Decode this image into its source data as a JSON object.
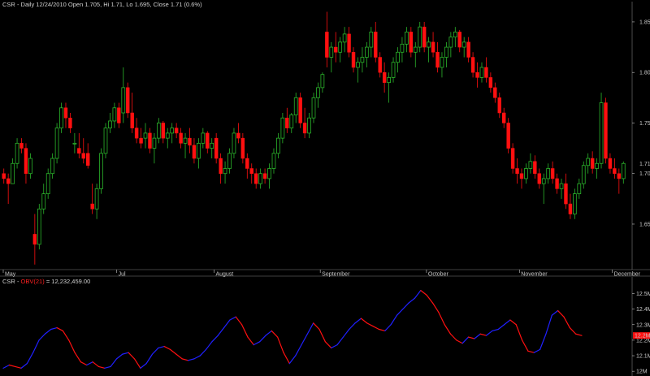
{
  "header": {
    "symbol": "CSR",
    "title": "Daily 12/24/2010 Open 1.705, Hi 1.71, Lo 1.695, Close 1.71 (0.6%)"
  },
  "indicator": {
    "symbol": "CSR",
    "name": "OBV(21)",
    "value": "= 12,232,459.00"
  },
  "colors": {
    "up": "#2bb52b",
    "down": "#ff1010",
    "obv_up": "#2020ff",
    "obv_down": "#ff1010",
    "axis": "#c8c8c8",
    "background": "#000000"
  },
  "chart_data": [
    {
      "type": "candlestick",
      "title": "CSR - Daily 12/24/2010 Open 1.705, Hi 1.71, Lo 1.695, Close 1.71 (0.6%)",
      "y_ticks": [
        "1.650",
        "1.700",
        "1.71",
        "1.750",
        "1.800",
        "1.850"
      ],
      "ylim": [
        1.605,
        1.862
      ],
      "x_months": [
        "May",
        "Jul",
        "August",
        "September",
        "October",
        "November",
        "December"
      ],
      "last_value": "1.71",
      "ohlc": [
        [
          1.7,
          1.705,
          1.69,
          1.695
        ],
        [
          1.695,
          1.7,
          1.67,
          1.69
        ],
        [
          1.69,
          1.715,
          1.69,
          1.71
        ],
        [
          1.71,
          1.735,
          1.705,
          1.73
        ],
        [
          1.73,
          1.735,
          1.72,
          1.725
        ],
        [
          1.725,
          1.73,
          1.69,
          1.7
        ],
        [
          1.7,
          1.72,
          1.695,
          1.715
        ],
        [
          1.64,
          1.66,
          1.61,
          1.63
        ],
        [
          1.63,
          1.67,
          1.625,
          1.665
        ],
        [
          1.665,
          1.69,
          1.66,
          1.68
        ],
        [
          1.68,
          1.705,
          1.675,
          1.7
        ],
        [
          1.7,
          1.72,
          1.695,
          1.715
        ],
        [
          1.715,
          1.75,
          1.71,
          1.745
        ],
        [
          1.745,
          1.77,
          1.74,
          1.765
        ],
        [
          1.765,
          1.77,
          1.745,
          1.755
        ],
        [
          1.755,
          1.76,
          1.74,
          1.745
        ],
        [
          1.73,
          1.74,
          1.72,
          1.73
        ],
        [
          1.725,
          1.74,
          1.715,
          1.72
        ],
        [
          1.72,
          1.735,
          1.71,
          1.715
        ],
        [
          1.72,
          1.73,
          1.705,
          1.708
        ],
        [
          1.67,
          1.69,
          1.66,
          1.665
        ],
        [
          1.665,
          1.69,
          1.655,
          1.685
        ],
        [
          1.685,
          1.725,
          1.68,
          1.72
        ],
        [
          1.72,
          1.75,
          1.715,
          1.745
        ],
        [
          1.745,
          1.76,
          1.74,
          1.752
        ],
        [
          1.752,
          1.77,
          1.745,
          1.765
        ],
        [
          1.765,
          1.77,
          1.745,
          1.75
        ],
        [
          1.76,
          1.805,
          1.75,
          1.785
        ],
        [
          1.785,
          1.79,
          1.755,
          1.76
        ],
        [
          1.76,
          1.78,
          1.74,
          1.745
        ],
        [
          1.745,
          1.755,
          1.73,
          1.735
        ],
        [
          1.735,
          1.745,
          1.725,
          1.73
        ],
        [
          1.735,
          1.75,
          1.725,
          1.74
        ],
        [
          1.74,
          1.745,
          1.72,
          1.725
        ],
        [
          1.725,
          1.74,
          1.71,
          1.735
        ],
        [
          1.735,
          1.755,
          1.73,
          1.75
        ],
        [
          1.75,
          1.752,
          1.73,
          1.735
        ],
        [
          1.735,
          1.745,
          1.725,
          1.74
        ],
        [
          1.74,
          1.75,
          1.73,
          1.745
        ],
        [
          1.745,
          1.75,
          1.735,
          1.74
        ],
        [
          1.74,
          1.745,
          1.725,
          1.73
        ],
        [
          1.73,
          1.74,
          1.715,
          1.735
        ],
        [
          1.735,
          1.745,
          1.72,
          1.728
        ],
        [
          1.728,
          1.735,
          1.71,
          1.715
        ],
        [
          1.715,
          1.735,
          1.705,
          1.73
        ],
        [
          1.73,
          1.745,
          1.725,
          1.74
        ],
        [
          1.74,
          1.742,
          1.72,
          1.725
        ],
        [
          1.725,
          1.735,
          1.715,
          1.73
        ],
        [
          1.735,
          1.74,
          1.71,
          1.715
        ],
        [
          1.715,
          1.72,
          1.69,
          1.7
        ],
        [
          1.7,
          1.712,
          1.69,
          1.705
        ],
        [
          1.705,
          1.725,
          1.7,
          1.72
        ],
        [
          1.72,
          1.745,
          1.715,
          1.74
        ],
        [
          1.74,
          1.75,
          1.73,
          1.735
        ],
        [
          1.735,
          1.74,
          1.71,
          1.715
        ],
        [
          1.715,
          1.72,
          1.695,
          1.705
        ],
        [
          1.705,
          1.71,
          1.69,
          1.7
        ],
        [
          1.7,
          1.705,
          1.685,
          1.69
        ],
        [
          1.69,
          1.705,
          1.685,
          1.7
        ],
        [
          1.7,
          1.705,
          1.69,
          1.695
        ],
        [
          1.695,
          1.71,
          1.685,
          1.705
        ],
        [
          1.705,
          1.725,
          1.7,
          1.72
        ],
        [
          1.72,
          1.74,
          1.715,
          1.735
        ],
        [
          1.735,
          1.76,
          1.73,
          1.755
        ],
        [
          1.755,
          1.765,
          1.74,
          1.745
        ],
        [
          1.745,
          1.76,
          1.74,
          1.758
        ],
        [
          1.758,
          1.78,
          1.75,
          1.775
        ],
        [
          1.775,
          1.78,
          1.745,
          1.75
        ],
        [
          1.75,
          1.765,
          1.735,
          1.74
        ],
        [
          1.74,
          1.76,
          1.735,
          1.755
        ],
        [
          1.755,
          1.78,
          1.75,
          1.775
        ],
        [
          1.775,
          1.79,
          1.765,
          1.785
        ],
        [
          1.785,
          1.8,
          1.78,
          1.798
        ],
        [
          1.84,
          1.86,
          1.805,
          1.815
        ],
        [
          1.815,
          1.83,
          1.8,
          1.825
        ],
        [
          1.825,
          1.84,
          1.81,
          1.82
        ],
        [
          1.82,
          1.835,
          1.81,
          1.83
        ],
        [
          1.83,
          1.845,
          1.82,
          1.838
        ],
        [
          1.838,
          1.845,
          1.815,
          1.82
        ],
        [
          1.82,
          1.825,
          1.8,
          1.805
        ],
        [
          1.805,
          1.815,
          1.79,
          1.81
        ],
        [
          1.81,
          1.825,
          1.8,
          1.815
        ],
        [
          1.815,
          1.83,
          1.805,
          1.825
        ],
        [
          1.825,
          1.845,
          1.815,
          1.84
        ],
        [
          1.84,
          1.85,
          1.81,
          1.815
        ],
        [
          1.815,
          1.82,
          1.795,
          1.8
        ],
        [
          1.8,
          1.81,
          1.78,
          1.79
        ],
        [
          1.79,
          1.8,
          1.77,
          1.795
        ],
        [
          1.795,
          1.815,
          1.79,
          1.81
        ],
        [
          1.81,
          1.825,
          1.8,
          1.82
        ],
        [
          1.82,
          1.835,
          1.81,
          1.828
        ],
        [
          1.828,
          1.845,
          1.82,
          1.84
        ],
        [
          1.84,
          1.845,
          1.815,
          1.82
        ],
        [
          1.82,
          1.83,
          1.805,
          1.825
        ],
        [
          1.825,
          1.85,
          1.82,
          1.845
        ],
        [
          1.845,
          1.85,
          1.82,
          1.825
        ],
        [
          1.825,
          1.835,
          1.81,
          1.83
        ],
        [
          1.83,
          1.84,
          1.815,
          1.82
        ],
        [
          1.82,
          1.83,
          1.8,
          1.805
        ],
        [
          1.805,
          1.82,
          1.795,
          1.815
        ],
        [
          1.815,
          1.83,
          1.805,
          1.825
        ],
        [
          1.825,
          1.84,
          1.815,
          1.835
        ],
        [
          1.835,
          1.845,
          1.825,
          1.84
        ],
        [
          1.84,
          1.842,
          1.82,
          1.825
        ],
        [
          1.825,
          1.835,
          1.815,
          1.83
        ],
        [
          1.83,
          1.835,
          1.81,
          1.815
        ],
        [
          1.815,
          1.82,
          1.795,
          1.8
        ],
        [
          1.8,
          1.81,
          1.785,
          1.795
        ],
        [
          1.795,
          1.81,
          1.79,
          1.805
        ],
        [
          1.805,
          1.815,
          1.79,
          1.795
        ],
        [
          1.795,
          1.8,
          1.78,
          1.785
        ],
        [
          1.785,
          1.79,
          1.77,
          1.775
        ],
        [
          1.775,
          1.78,
          1.755,
          1.76
        ],
        [
          1.76,
          1.765,
          1.745,
          1.75
        ],
        [
          1.75,
          1.755,
          1.72,
          1.725
        ],
        [
          1.725,
          1.73,
          1.7,
          1.705
        ],
        [
          1.705,
          1.715,
          1.69,
          1.7
        ],
        [
          1.7,
          1.705,
          1.685,
          1.695
        ],
        [
          1.695,
          1.71,
          1.69,
          1.705
        ],
        [
          1.705,
          1.72,
          1.7,
          1.712
        ],
        [
          1.712,
          1.718,
          1.695,
          1.7
        ],
        [
          1.7,
          1.705,
          1.685,
          1.69
        ],
        [
          1.69,
          1.7,
          1.67,
          1.695
        ],
        [
          1.695,
          1.71,
          1.69,
          1.705
        ],
        [
          1.705,
          1.712,
          1.69,
          1.695
        ],
        [
          1.695,
          1.7,
          1.68,
          1.685
        ],
        [
          1.685,
          1.695,
          1.675,
          1.69
        ],
        [
          1.69,
          1.7,
          1.665,
          1.67
        ],
        [
          1.67,
          1.68,
          1.655,
          1.66
        ],
        [
          1.66,
          1.685,
          1.655,
          1.68
        ],
        [
          1.68,
          1.695,
          1.675,
          1.69
        ],
        [
          1.69,
          1.712,
          1.685,
          1.708
        ],
        [
          1.708,
          1.72,
          1.7,
          1.715
        ],
        [
          1.715,
          1.722,
          1.7,
          1.705
        ],
        [
          1.705,
          1.715,
          1.695,
          1.71
        ],
        [
          1.71,
          1.78,
          1.705,
          1.77
        ],
        [
          1.77,
          1.775,
          1.71,
          1.715
        ],
        [
          1.715,
          1.72,
          1.7,
          1.705
        ],
        [
          1.705,
          1.715,
          1.695,
          1.7
        ],
        [
          1.7,
          1.705,
          1.68,
          1.695
        ],
        [
          1.695,
          1.712,
          1.69,
          1.71
        ]
      ]
    },
    {
      "type": "line",
      "title": "CSR - OBV(21) = 12,232,459.00",
      "y_ticks": [
        "12M",
        "12.1M",
        "12.2M",
        "12.3M",
        "12.4M",
        "12.5M"
      ],
      "ylim": [
        11.98,
        12.56
      ],
      "last_label": "12.2M",
      "series": [
        {
          "values": [
            12.02,
            12.04,
            12.03,
            12.02,
            12.05,
            12.12,
            12.2,
            12.24,
            12.27,
            12.28,
            12.26,
            12.2,
            12.12,
            12.06,
            12.04,
            12.06,
            12.03,
            12.02,
            12.03,
            12.08,
            12.11,
            12.12,
            12.08,
            12.02,
            12.05,
            12.11,
            12.15,
            12.16,
            12.14,
            12.11,
            12.08,
            12.07,
            12.08,
            12.1,
            12.14,
            12.19,
            12.23,
            12.28,
            12.33,
            12.35,
            12.3,
            12.22,
            12.17,
            12.19,
            12.23,
            12.26,
            12.22,
            12.12,
            12.05,
            12.1,
            12.17,
            12.24,
            12.31,
            12.27,
            12.19,
            12.15,
            12.17,
            12.22,
            12.27,
            12.31,
            12.34,
            12.31,
            12.29,
            12.27,
            12.26,
            12.3,
            12.36,
            12.4,
            12.44,
            12.47,
            12.52,
            12.49,
            12.44,
            12.38,
            12.3,
            12.24,
            12.2,
            12.18,
            12.22,
            12.21,
            12.24,
            12.23,
            12.26,
            12.27,
            12.3,
            12.33,
            12.3,
            12.2,
            12.13,
            12.12,
            12.14,
            12.24,
            12.36,
            12.39,
            12.35,
            12.28,
            12.24,
            12.23
          ]
        }
      ]
    }
  ]
}
